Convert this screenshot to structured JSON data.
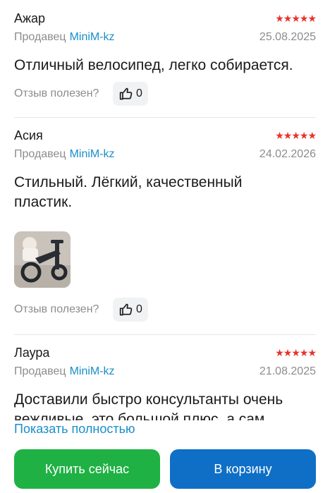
{
  "colors": {
    "accent_link": "#1a8ec8",
    "star": "#e7322e",
    "buy": "#1fb144",
    "cart": "#0f6fc6"
  },
  "reviews": [
    {
      "author": "Ажар",
      "seller_label": "Продавец",
      "seller_name": "MiniM-kz",
      "date": "25.08.2025",
      "text": "Отличный велосипед, легко собирается.",
      "helpful_label": "Отзыв полезен?",
      "likes": "0",
      "rating": 5
    },
    {
      "author": "Асия",
      "seller_label": "Продавец",
      "seller_name": "MiniM-kz",
      "date": "24.02.2026",
      "text": "Стильный. Лёгкий, качественный пластик.",
      "helpful_label": "Отзыв полезен?",
      "likes": "0",
      "rating": 5
    },
    {
      "author": "Лаура",
      "seller_label": "Продавец",
      "seller_name": "MiniM-kz",
      "date": "21.08.2025",
      "text": "Доставили быстро консультанты очень вежливые, это большой плюс, а сам",
      "rating": 5
    }
  ],
  "show_more": "Показать полностью",
  "actions": {
    "buy_now": "Купить сейчас",
    "add_to_cart": "В корзину"
  }
}
